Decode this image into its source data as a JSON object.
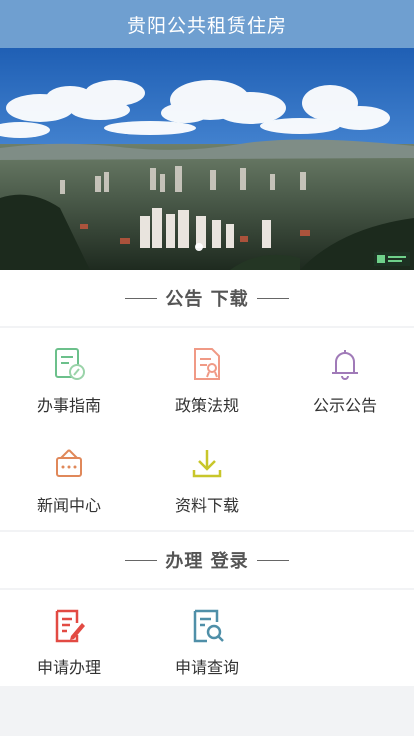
{
  "header": {
    "title": "贵阳公共租赁住房"
  },
  "banner": {
    "active_slide": 1,
    "slide_count": 1
  },
  "announcements": {
    "title": "公告 下载",
    "items": [
      {
        "label": "办事指南",
        "icon": "guide-icon",
        "color": "#6cc08b"
      },
      {
        "label": "政策法规",
        "icon": "policy-document-icon",
        "color": "#f09a86"
      },
      {
        "label": "公示公告",
        "icon": "bell-icon",
        "color": "#a07ab8"
      },
      {
        "label": "新闻中心",
        "icon": "news-board-icon",
        "color": "#e0885a"
      },
      {
        "label": "资料下载",
        "icon": "download-icon",
        "color": "#c8c62a"
      }
    ]
  },
  "services": {
    "title": "办理 登录",
    "items": [
      {
        "label": "申请办理",
        "icon": "apply-edit-icon",
        "color": "#e24a43"
      },
      {
        "label": "申请查询",
        "icon": "search-document-icon",
        "color": "#4f8fa8"
      }
    ]
  }
}
